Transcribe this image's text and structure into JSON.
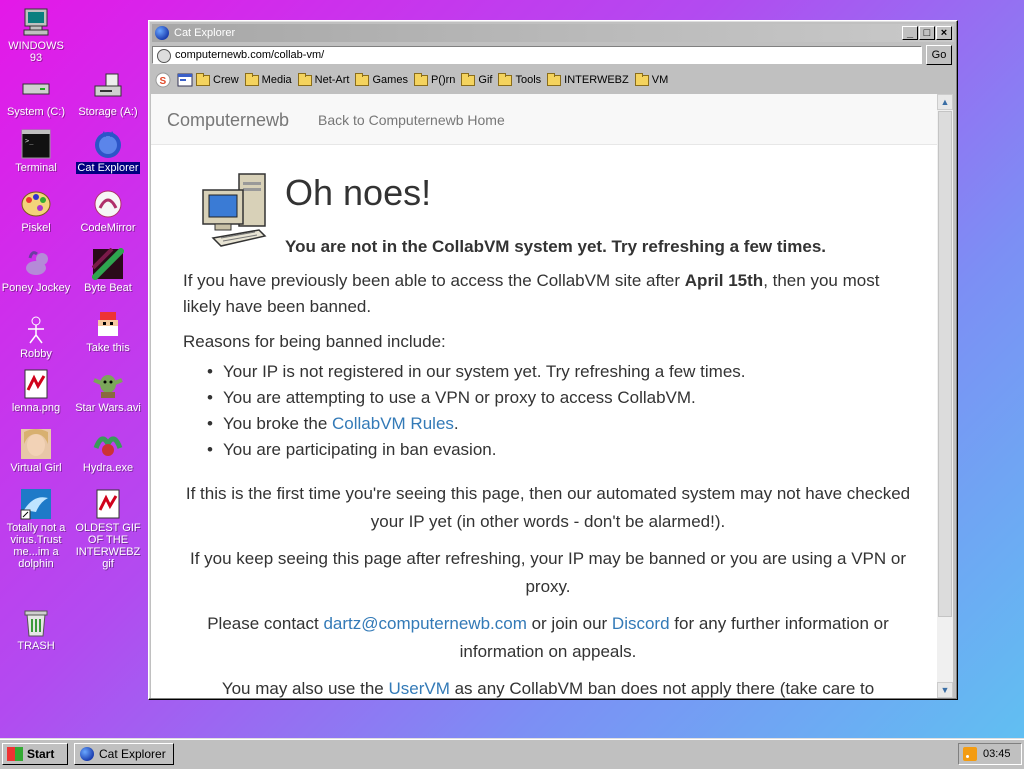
{
  "desktop": {
    "icons": [
      {
        "label": "WINDOWS 93",
        "icon": "computer-icon"
      },
      {
        "label": "System (C:)",
        "icon": "drive-icon"
      },
      {
        "label": "Storage (A:)",
        "icon": "floppy-drive-icon"
      },
      {
        "label": "Terminal",
        "icon": "terminal-icon"
      },
      {
        "label": "Cat Explorer",
        "icon": "cat-explorer-icon"
      },
      {
        "label": "Piskel",
        "icon": "palette-icon"
      },
      {
        "label": "CodeMirror",
        "icon": "codemirror-icon"
      },
      {
        "label": "Poney Jockey",
        "icon": "pony-icon"
      },
      {
        "label": "Byte Beat",
        "icon": "bytebeat-icon"
      },
      {
        "label": "Robby",
        "icon": "stick-figure-icon"
      },
      {
        "label": "Take this",
        "icon": "pixel-character-icon"
      },
      {
        "label": "lenna.png",
        "icon": "image-file-icon"
      },
      {
        "label": "Star Wars.avi",
        "icon": "yoda-icon"
      },
      {
        "label": "Virtual Girl",
        "icon": "face-icon"
      },
      {
        "label": "Hydra.exe",
        "icon": "hydra-icon"
      },
      {
        "label": "Totally not a virus.Trust me...im a dolphin",
        "icon": "dolphin-icon"
      },
      {
        "label": "OLDEST GIF OF THE INTERWEBZ gif",
        "icon": "gif-file-icon"
      },
      {
        "label": "TRASH",
        "icon": "trash-icon"
      }
    ]
  },
  "window": {
    "title": "Cat Explorer",
    "address": "computernewb.com/collab-vm/",
    "go_label": "Go",
    "bookmarks": [
      "Crew",
      "Media",
      "Net-Art",
      "Games",
      "P()rn",
      "Gif",
      "Tools",
      "INTERWEBZ",
      "VM"
    ]
  },
  "page": {
    "brand": "Computernewb",
    "nav_link": "Back to Computernewb Home",
    "heading": "Oh noes!",
    "lead": "You are not in the CollabVM system yet. Try refreshing a few times.",
    "p1_before": "If you have previously been able to access the CollabVM site after ",
    "p1_bold": "April 15th",
    "p1_after": ", then you most likely have been banned.",
    "p2": "Reasons for being banned include:",
    "reasons": [
      "Your IP is not registered in our system yet. Try refreshing a few times.",
      "You are attempting to use a VPN or proxy to access CollabVM.",
      "You broke the ",
      "You are participating in ban evasion."
    ],
    "rules_link": "CollabVM Rules",
    "rules_after": ".",
    "c1": "If this is the first time you're seeing this page, then our automated system may not have checked your IP yet (in other words - don't be alarmed!).",
    "c2": "If you keep seeing this page after refreshing, your IP may be banned or you are using a VPN or proxy.",
    "c3_before": "Please contact ",
    "c3_email": "dartz@computernewb.com",
    "c3_mid": " or join our ",
    "c3_discord": "Discord",
    "c3_after": " for any further information or information on appeals.",
    "c4_before": "You may also use the ",
    "c4_link": "UserVM",
    "c4_after": " as any CollabVM ban does not apply there (take care to"
  },
  "taskbar": {
    "start_label": "Start",
    "task_label": "Cat Explorer",
    "clock": "03:45"
  },
  "colors": {
    "link": "#337ab7",
    "selection": "#000080"
  }
}
